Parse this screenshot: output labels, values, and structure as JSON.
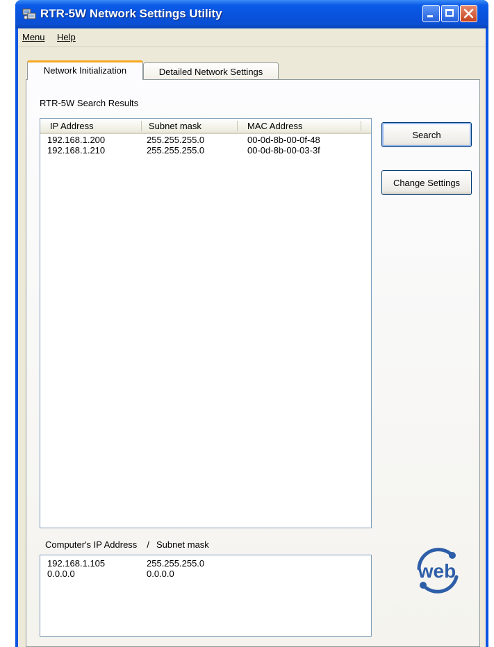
{
  "window": {
    "title": "RTR-5W Network Settings Utility"
  },
  "menu": {
    "items": [
      {
        "label": "Menu"
      },
      {
        "label": "Help"
      }
    ]
  },
  "tabs": [
    {
      "label": "Network Initialization",
      "active": true
    },
    {
      "label": "Detailed Network Settings",
      "active": false
    }
  ],
  "search_results": {
    "label": "RTR-5W Search Results",
    "columns": [
      "IP Address",
      "Subnet mask",
      "MAC Address"
    ],
    "rows": [
      {
        "ip": "192.168.1.200",
        "subnet": "255.255.255.0",
        "mac": "00-0d-8b-00-0f-48"
      },
      {
        "ip": "192.168.1.210",
        "subnet": "255.255.255.0",
        "mac": "00-0d-8b-00-03-3f"
      }
    ]
  },
  "buttons": {
    "search": "Search",
    "change_settings": "Change Settings"
  },
  "computer": {
    "label_ip": "Computer's IP Address",
    "label_sep": "/",
    "label_subnet": "Subnet mask",
    "rows": [
      {
        "ip": "192.168.1.105",
        "subnet": "255.255.255.0"
      },
      {
        "ip": "0.0.0.0",
        "subnet": "0.0.0.0"
      }
    ]
  },
  "logo": {
    "text": "web",
    "color": "#2e5ea8"
  }
}
